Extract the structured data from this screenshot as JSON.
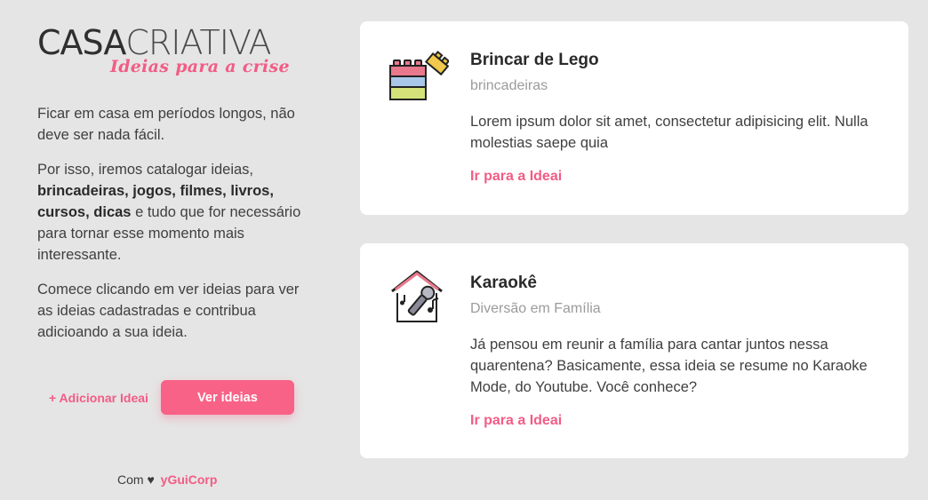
{
  "logo": {
    "part1": "CASA",
    "part2": "CRIATIVA",
    "tagline": "Ideias para a crise"
  },
  "intro": {
    "p1": "Ficar em casa em períodos longos, não deve ser nada fácil.",
    "p2_start": "Por isso, iremos catalogar ideias, ",
    "p2_bold": "brincadeiras, jogos, filmes, livros, cursos, dicas",
    "p2_end": " e tudo que for necessário para tornar esse momento mais interessante.",
    "p3": "Comece clicando em ver ideias para ver as ideias cadastradas e contribua adicioando a sua ideia."
  },
  "actions": {
    "add_label": "+ Adicionar Ideai",
    "view_label": "Ver ideias"
  },
  "footer": {
    "prefix": "Com ♥",
    "brand": "yGuiCorp"
  },
  "cards": [
    {
      "icon": "lego-blocks-icon",
      "title": "Brincar de Lego",
      "category": "brincadeiras",
      "description": "Lorem ipsum dolor sit amet, consectetur adipisicing elit. Nulla molestias saepe quia",
      "link": "Ir para a Ideai"
    },
    {
      "icon": "karaoke-house-icon",
      "title": "Karaokê",
      "category": "Diversão em Família",
      "description": "Já pensou em reunir a família para cantar juntos nessa quarentena? Basicamente, essa ideia se resume no Karaoke Mode, do Youtube. Você conhece?",
      "link": "Ir para a Ideai"
    }
  ],
  "colors": {
    "accent": "#f25c85",
    "button": "#f86286",
    "background": "#e5e5e5",
    "card": "#ffffff"
  }
}
